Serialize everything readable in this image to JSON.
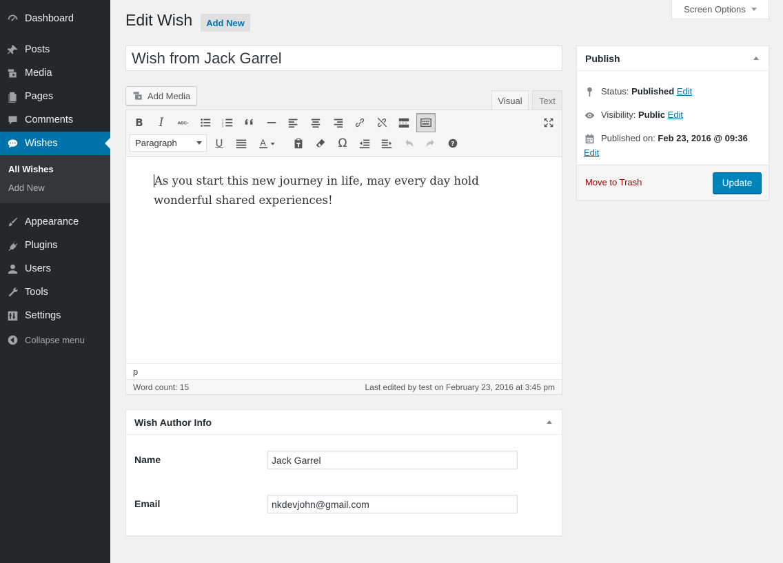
{
  "sidebar": {
    "menu": [
      {
        "label": "Dashboard",
        "icon": "dashboard-icon"
      },
      {
        "label": "Posts",
        "icon": "pin-icon"
      },
      {
        "label": "Media",
        "icon": "media-icon"
      },
      {
        "label": "Pages",
        "icon": "pages-icon"
      },
      {
        "label": "Comments",
        "icon": "comment-icon"
      },
      {
        "label": "Wishes",
        "icon": "speech-bubble-icon"
      }
    ],
    "submenu": [
      "All Wishes",
      "Add New"
    ],
    "menu2": [
      {
        "label": "Appearance",
        "icon": "brush-icon"
      },
      {
        "label": "Plugins",
        "icon": "plugin-icon"
      },
      {
        "label": "Users",
        "icon": "user-icon"
      },
      {
        "label": "Tools",
        "icon": "wrench-icon"
      },
      {
        "label": "Settings",
        "icon": "settings-icon"
      }
    ],
    "collapse": "Collapse menu"
  },
  "header": {
    "title": "Edit Wish",
    "add_new": "Add New",
    "screen_options": "Screen Options"
  },
  "post": {
    "title": "Wish from Jack Garrel"
  },
  "editor": {
    "add_media": "Add Media",
    "tab_visual": "Visual",
    "tab_text": "Text",
    "format": "Paragraph",
    "content": "As you start this new journey in life, may every day hold wonderful shared experiences!",
    "path": "p",
    "word_count": "Word count: 15",
    "last_edited": "Last edited by test on February 23, 2016 at 3:45 pm"
  },
  "author_box": {
    "title": "Wish Author Info",
    "name_label": "Name",
    "name_value": "Jack Garrel",
    "email_label": "Email",
    "email_value": "nkdevjohn@gmail.com"
  },
  "publish": {
    "title": "Publish",
    "status_label": "Status:",
    "status_value": "Published",
    "visibility_label": "Visibility:",
    "visibility_value": "Public",
    "published_label": "Published on:",
    "published_value": "Feb 23, 2016 @ 09:36",
    "edit": "Edit",
    "trash": "Move to Trash",
    "update": "Update"
  },
  "colors": {
    "sidebar_bg": "#23282d",
    "active": "#0073aa",
    "button_primary": "#0085ba",
    "trash": "#aa0000"
  }
}
